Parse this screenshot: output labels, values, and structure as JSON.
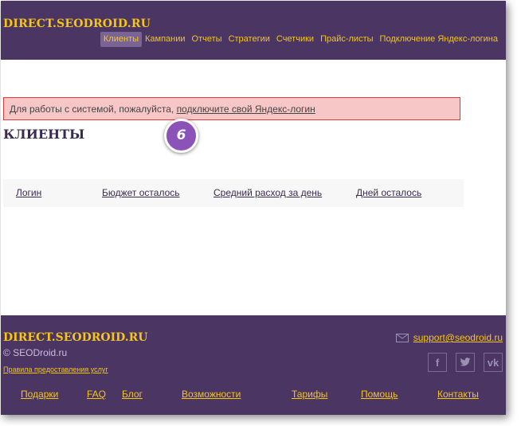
{
  "header": {
    "brand": "DIRECT.SEODROID.RU",
    "nav": [
      {
        "label": "Клиенты",
        "active": true
      },
      {
        "label": "Кампании",
        "active": false
      },
      {
        "label": "Отчеты",
        "active": false
      },
      {
        "label": "Стратегии",
        "active": false
      },
      {
        "label": "Счетчики",
        "active": false
      },
      {
        "label": "Прайс-листы",
        "active": false
      },
      {
        "label": "Подключение Яндекс-логина",
        "active": false
      }
    ]
  },
  "alert": {
    "text": "Для работы с системой, пожалуйста, ",
    "link": "подключите свой Яндекс-логин"
  },
  "step_badge": "6",
  "main": {
    "title": "КЛИЕНТЫ",
    "columns": [
      "Логин",
      "Бюджет осталось",
      "Средний расход за день",
      "Дней осталось"
    ]
  },
  "footer": {
    "brand": "DIRECT.SEODROID.RU",
    "copyright": "© SEODroid.ru",
    "rules": "Правила предоставления услуг",
    "email": "support@seodroid.ru",
    "socials": [
      {
        "icon": "facebook-icon",
        "glyph": "f"
      },
      {
        "icon": "twitter-icon",
        "glyph": "t"
      },
      {
        "icon": "vk-icon",
        "glyph": "vk"
      }
    ],
    "nav": [
      "Подарки",
      "FAQ",
      "Блог",
      "Возможности",
      "Тарифы",
      "Помощь",
      "Контакты"
    ]
  },
  "colors": {
    "purple": "#4a3563",
    "yellow": "#f5c518",
    "alert_bg": "#f7c7c7",
    "alert_border": "#e03b3b",
    "badge": "#8b52b8"
  }
}
